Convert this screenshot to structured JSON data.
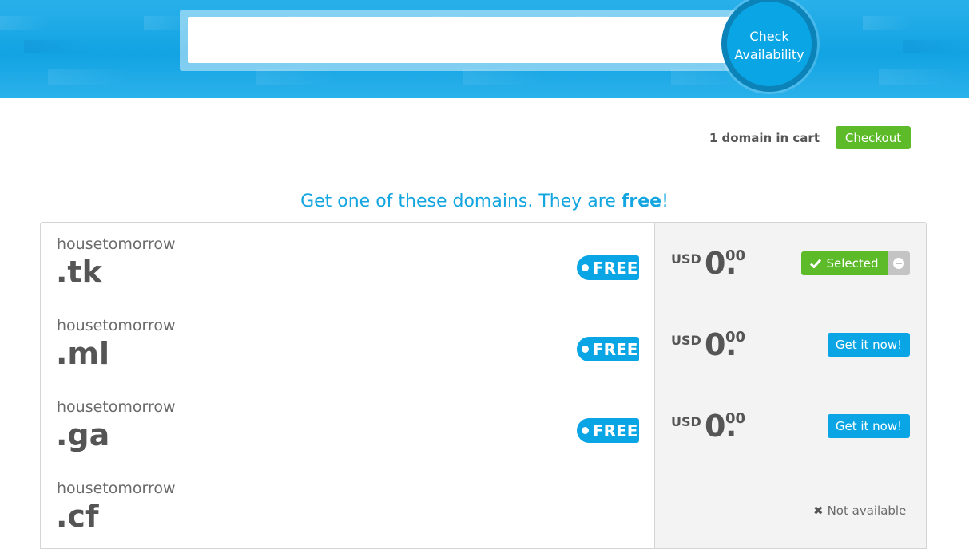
{
  "search": {
    "value": "",
    "placeholder": "",
    "button_line1": "Check",
    "button_line2": "Availability"
  },
  "cart": {
    "text": "1 domain in cart",
    "checkout_label": "Checkout"
  },
  "heading": {
    "prefix": "Get one of these domains. They are ",
    "emphasis": "free",
    "suffix": "!"
  },
  "domains": [
    {
      "name": "housetomorrow",
      "tld": ".tk",
      "badge": "FREE",
      "currency": "USD",
      "price_int": "0",
      "price_dec": "00",
      "action": "Selected",
      "status": "selected"
    },
    {
      "name": "housetomorrow",
      "tld": ".ml",
      "badge": "FREE",
      "currency": "USD",
      "price_int": "0",
      "price_dec": "00",
      "action": "Get it now!",
      "status": "available"
    },
    {
      "name": "housetomorrow",
      "tld": ".ga",
      "badge": "FREE",
      "currency": "USD",
      "price_int": "0",
      "price_dec": "00",
      "action": "Get it now!",
      "status": "available"
    },
    {
      "name": "housetomorrow",
      "tld": ".cf",
      "action": "Not available",
      "status": "unavailable"
    }
  ],
  "colors": {
    "brand_blue": "#0aa5e4",
    "green": "#5dbb2a",
    "text": "#555555",
    "panel": "#f3f3f3"
  },
  "icons": {
    "selected": "check-icon",
    "remove": "minus-circle-icon",
    "unavailable": "x-icon",
    "badge": "dot-icon"
  }
}
